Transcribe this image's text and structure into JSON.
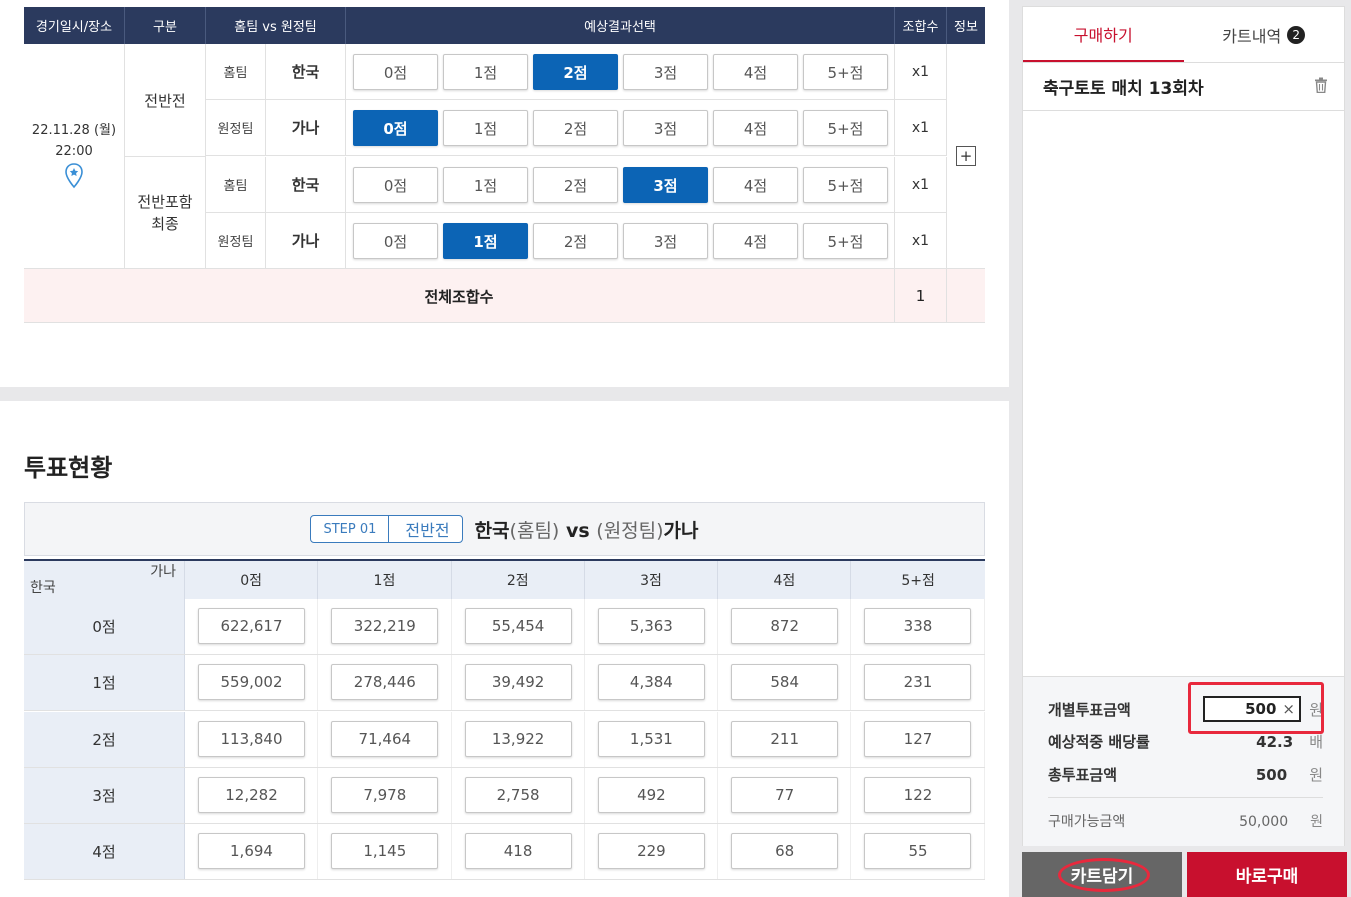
{
  "selection_table": {
    "headers": [
      "경기일시/장소",
      "구분",
      "홈팀 vs 원정팀",
      "예상결과선택",
      "조합수",
      "정보"
    ],
    "date": "22.11.28 (월)",
    "time": "22:00",
    "sections": [
      {
        "label": "전반전",
        "rows": [
          {
            "side": "홈팀",
            "team": "한국",
            "selected": 2,
            "combo": "x1"
          },
          {
            "side": "원정팀",
            "team": "가나",
            "selected": 0,
            "combo": "x1"
          }
        ]
      },
      {
        "label": "전반포함\n최종",
        "rows": [
          {
            "side": "홈팀",
            "team": "한국",
            "selected": 3,
            "combo": "x1"
          },
          {
            "side": "원정팀",
            "team": "가나",
            "selected": 1,
            "combo": "x1"
          }
        ]
      }
    ],
    "score_options": [
      "0점",
      "1점",
      "2점",
      "3점",
      "4점",
      "5+점"
    ],
    "total_label": "전체조합수",
    "total_value": "1",
    "plus_symbol": "+"
  },
  "vote": {
    "title": "투표현황",
    "step_label": "STEP 01",
    "step_name": "전반전",
    "home_team": "한국",
    "home_tag": "(홈팀)",
    "vs": " vs ",
    "away_tag": "(원정팀)",
    "away_team": "가나",
    "corner_away": "가나",
    "corner_home": "한국",
    "columns": [
      "0점",
      "1점",
      "2점",
      "3점",
      "4점",
      "5+점"
    ],
    "rows": [
      {
        "label": "0점",
        "values": [
          "622,617",
          "322,219",
          "55,454",
          "5,363",
          "872",
          "338"
        ]
      },
      {
        "label": "1점",
        "values": [
          "559,002",
          "278,446",
          "39,492",
          "4,384",
          "584",
          "231"
        ]
      },
      {
        "label": "2점",
        "values": [
          "113,840",
          "71,464",
          "13,922",
          "1,531",
          "211",
          "127"
        ]
      },
      {
        "label": "3점",
        "values": [
          "12,282",
          "7,978",
          "2,758",
          "492",
          "77",
          "122"
        ]
      },
      {
        "label": "4점",
        "values": [
          "1,694",
          "1,145",
          "418",
          "229",
          "68",
          "55"
        ]
      }
    ]
  },
  "cart": {
    "tab_buy": "구매하기",
    "tab_history": "카트내역",
    "history_count": "2",
    "game_title": "축구토토 매치 13회차",
    "amount_label": "개별투표금액",
    "amount_value": "500",
    "amount_unit": "원",
    "odds_label": "예상적중 배당률",
    "odds_value": "42.3",
    "odds_unit": "배",
    "total_label": "총투표금액",
    "total_value": "500",
    "total_unit": "원",
    "available_label": "구매가능금액",
    "available_value": "50,000",
    "available_unit": "원",
    "cart_button": "카트담기",
    "buy_button": "바로구매"
  },
  "colors": {
    "navy": "#2b3a5e",
    "selected": "#0c64b5",
    "accent": "#c8102e"
  }
}
